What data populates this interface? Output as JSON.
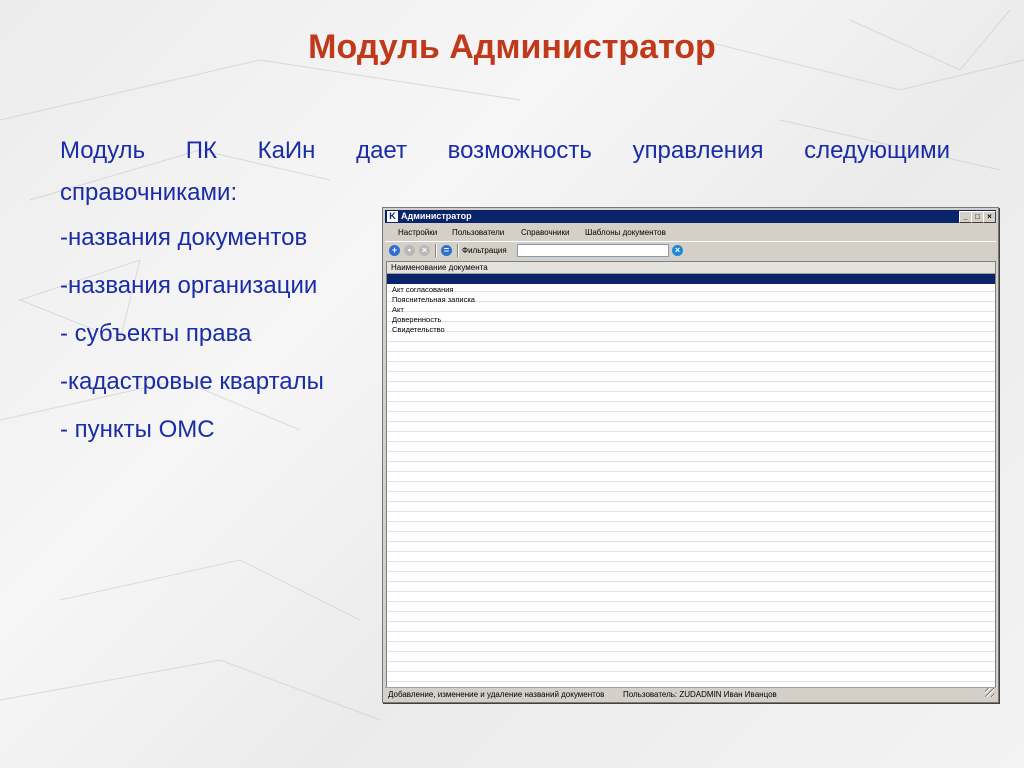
{
  "slide": {
    "title": "Модуль Администратор",
    "intro_line1_words": [
      "Модуль",
      "ПК",
      "КаИн",
      "дает",
      "возможность",
      "управления",
      "следующими"
    ],
    "intro_line2": "справочниками:",
    "bullets": [
      "-названия документов",
      "-названия организации",
      "- субъекты права",
      "-кадастровые кварталы",
      "- пункты ОМС"
    ]
  },
  "window": {
    "app_icon": "K",
    "title": "Администратор",
    "controls": [
      "_",
      "□",
      "×"
    ],
    "menu": [
      "Настройки",
      "Пользователи",
      "Справочники",
      "Шаблоны документов"
    ],
    "toolbar": {
      "icons": [
        "add-icon",
        "edit-icon",
        "delete-icon",
        "filter-icon"
      ],
      "filter_label": "Фильтрация",
      "filter_value": ""
    },
    "grid": {
      "column": "Наименование документа",
      "rows": [
        "Акт согласования",
        "Пояснительная записка",
        "Акт",
        "Доверенность",
        "Свидетельство"
      ]
    },
    "status": {
      "hint": "Добавление, изменение и удаление названий документов",
      "user": "Пользователь: ZUDADMIN  Иван Иванцов"
    }
  },
  "colors": {
    "title": "#c1391b",
    "body_text": "#1a2ca6",
    "titlebar": "#0a246a"
  }
}
